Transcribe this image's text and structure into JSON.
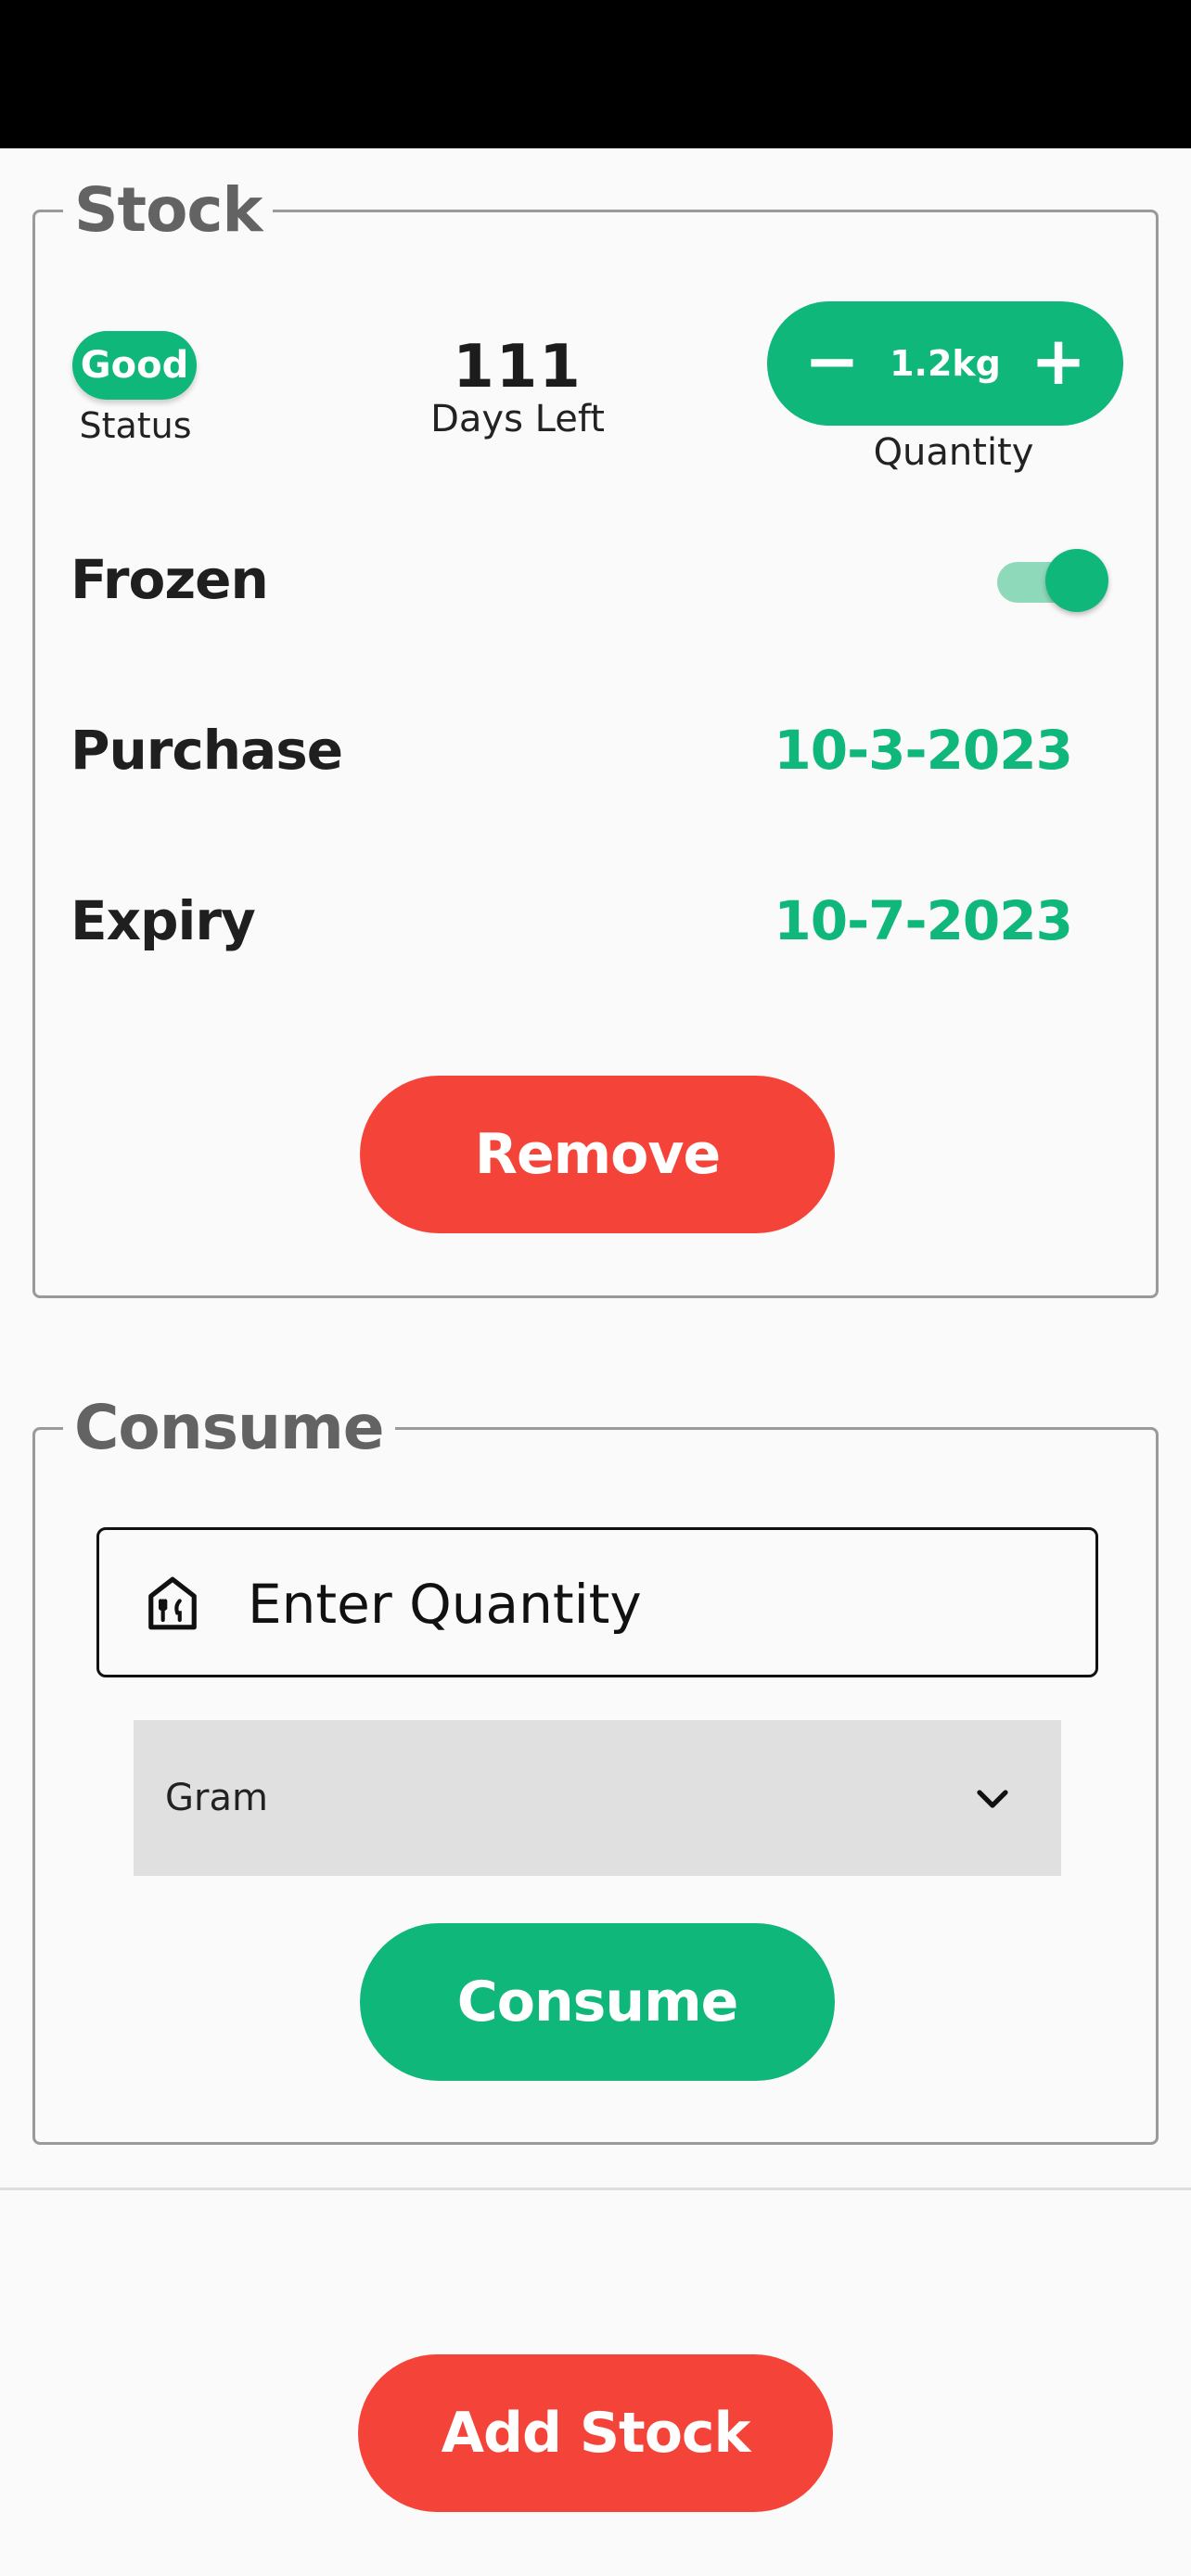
{
  "colors": {
    "accent": "#10b77a",
    "danger": "#f4443a",
    "text": "#1f1f1f",
    "legend": "#636363"
  },
  "stock": {
    "legend": "Stock",
    "status": {
      "value": "Good",
      "label": "Status"
    },
    "days": {
      "value": "111",
      "label": "Days Left"
    },
    "quantity": {
      "minus": "−",
      "value": "1.2kg",
      "plus": "+",
      "label": "Quantity"
    },
    "frozen": {
      "label": "Frozen",
      "on": true
    },
    "purchase": {
      "label": "Purchase",
      "value": "10-3-2023"
    },
    "expiry": {
      "label": "Expiry",
      "value": "10-7-2023"
    },
    "remove_label": "Remove"
  },
  "consume": {
    "legend": "Consume",
    "input": {
      "placeholder": "Enter Quantity",
      "icon": "house-utensils-icon"
    },
    "unit": {
      "selected": "Gram",
      "icon": "chevron-down-icon"
    },
    "button_label": "Consume"
  },
  "footer": {
    "add_stock_label": "Add Stock"
  }
}
